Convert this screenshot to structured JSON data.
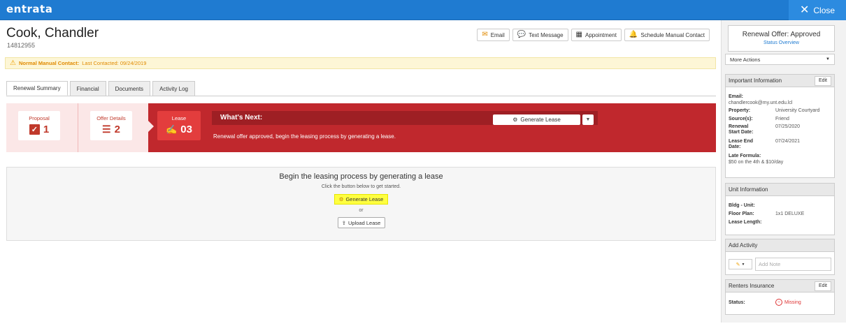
{
  "app": {
    "logo": "entrata",
    "close_label": "Close"
  },
  "resident": {
    "name": "Cook, Chandler",
    "id": "14812955"
  },
  "actions": [
    {
      "label": "Email",
      "icon": "email-icon"
    },
    {
      "label": "Text Message",
      "icon": "chat-icon"
    },
    {
      "label": "Appointment",
      "icon": "calendar-icon"
    },
    {
      "label": "Schedule Manual Contact",
      "icon": "bell-icon"
    }
  ],
  "alert": {
    "bold": "Normal Manual Contact:",
    "text": "Last Contacted: 09/24/2019"
  },
  "tabs": [
    "Renewal Summary",
    "Financial",
    "Documents",
    "Activity Log"
  ],
  "progress": {
    "proposal": {
      "label": "Proposal",
      "value": "1"
    },
    "offer": {
      "label": "Offer Details",
      "value": "2"
    },
    "lease": {
      "label": "Lease",
      "value": "03"
    },
    "next_title": "What's Next:",
    "next_desc": "Renewal offer approved, begin the leasing process by generating a lease.",
    "generate_btn": "Generate Lease"
  },
  "panel": {
    "title": "Begin the leasing process by generating a lease",
    "sub": "Click the button below to get started.",
    "generate_btn": "Generate Lease",
    "or": "or",
    "upload_btn": "Upload Lease"
  },
  "sidebar": {
    "offer_title": "Renewal Offer: Approved",
    "offer_link": "Status Overview",
    "more_actions": "More Actions",
    "important": {
      "title": "Important Information",
      "edit": "Edit",
      "email_label": "Email:",
      "email_value": "chandlercook@my.unt.edu.lcl",
      "property_label": "Property:",
      "property_value": "University Courtyard",
      "sources_label": "Source(s):",
      "sources_value": "Friend",
      "renewal_start_label": "Renewal Start Date:",
      "renewal_start_value": "07/25/2020",
      "lease_end_label": "Lease End Date:",
      "lease_end_value": "07/24/2021",
      "late_formula_label": "Late Formula:",
      "late_formula_value": "$50 on the 4th & $10/day"
    },
    "unit": {
      "title": "Unit Information",
      "bldg_label": "Bldg - Unit:",
      "floor_label": "Floor Plan:",
      "floor_value": "1x1 DELUXE",
      "lease_length_label": "Lease Length:"
    },
    "activity": {
      "title": "Add Activity",
      "placeholder": "Add Note"
    },
    "insurance": {
      "title": "Renters Insurance",
      "edit": "Edit",
      "status_label": "Status:",
      "status_value": "Missing"
    }
  },
  "colors": {
    "brand_blue": "#1f7bd1",
    "lease_red": "#c0282d",
    "alert_orange": "#e08a00",
    "highlight_yellow": "#ffff40"
  }
}
